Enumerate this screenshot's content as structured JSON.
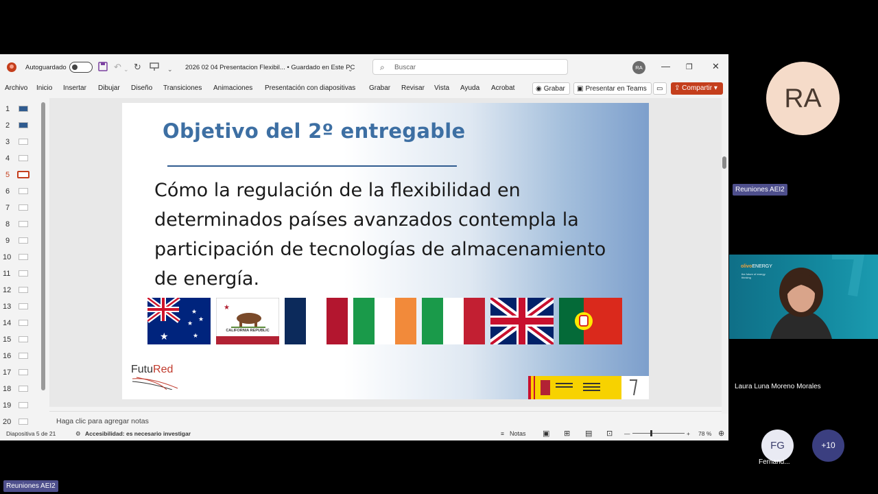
{
  "window": {
    "autosave_label": "Autoguardado",
    "doc_name": "2026 02 04 Presentacion Flexibil...  •  Guardado en Este PC",
    "search_placeholder": "Buscar",
    "user_initials": "RA"
  },
  "ribbon": {
    "tabs": [
      "Archivo",
      "Inicio",
      "Insertar",
      "Dibujar",
      "Diseño",
      "Transiciones",
      "Animaciones",
      "Presentación con diapositivas",
      "Grabar",
      "Revisar",
      "Vista",
      "Ayuda",
      "Acrobat"
    ],
    "record_label": "Grabar",
    "teams_label": "Presentar en Teams",
    "share_label": "Compartir"
  },
  "thumbnails": {
    "numbers": [
      "1",
      "2",
      "3",
      "4",
      "5",
      "6",
      "7",
      "8",
      "9",
      "10",
      "11",
      "12",
      "13",
      "14",
      "15",
      "16",
      "17",
      "18",
      "19",
      "20"
    ],
    "active": 5
  },
  "slide": {
    "title": "Objetivo del 2º entregable",
    "body": "Cómo la regulación de la flexibilidad en determinados países avanzados contempla la participación de tecnologías de almacenamiento de energía.",
    "flags": [
      "australia-flag",
      "california-flag",
      "france-flag",
      "ireland-flag",
      "italy-flag",
      "uk-flag",
      "portugal-flag"
    ],
    "california_text": "CALIFORNIA REPUBLIC",
    "logo_futu": "Futu",
    "logo_red": "Red"
  },
  "notes_placeholder": "Haga clic para agregar notas",
  "status": {
    "slide_counter": "Diapositiva 5 de 21",
    "accessibility": "Accesibilidad: es necesario investigar",
    "notes_label": "Notas",
    "zoom": "78 %"
  },
  "teams": {
    "presenter_initials": "RA",
    "meeting_tag": "Reuniones AEI2",
    "participant_name": "Laura Luna Moreno Morales",
    "video_brand_a": "olivo",
    "video_brand_b": "ENERGY",
    "video_sub": "the future of energy thinking",
    "fg_initials": "FG",
    "fg_name": "Fernand...",
    "more_count": "+10",
    "bottom_tag": "Reuniones AEI2"
  }
}
